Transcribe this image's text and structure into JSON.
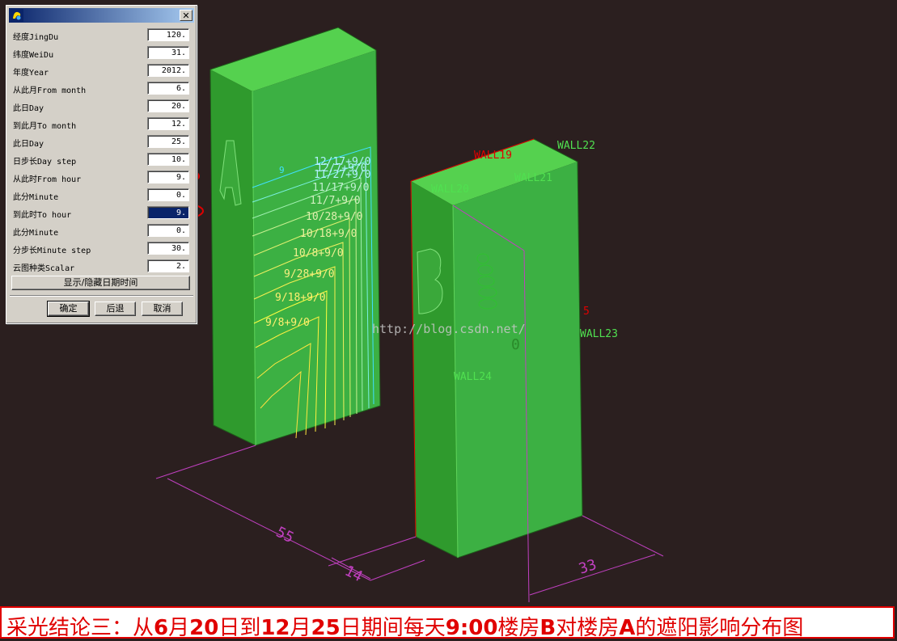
{
  "dialog": {
    "close_label": "✕",
    "fields": [
      {
        "label": "经度JingDu",
        "value": "120."
      },
      {
        "label": "纬度WeiDu",
        "value": "31."
      },
      {
        "label": "年度Year",
        "value": "2012."
      },
      {
        "label": "从此月From month",
        "value": "6."
      },
      {
        "label": "此日Day",
        "value": "20."
      },
      {
        "label": "到此月To month",
        "value": "12."
      },
      {
        "label": "此日Day",
        "value": "25."
      },
      {
        "label": "日步长Day step",
        "value": "10."
      },
      {
        "label": "从此时From hour",
        "value": "9."
      },
      {
        "label": "此分Minute",
        "value": "0."
      },
      {
        "label": "到此时To hour",
        "value": "9."
      },
      {
        "label": "此分Minute",
        "value": "0."
      },
      {
        "label": "分步长Minute step",
        "value": "30."
      },
      {
        "label": "云图种类Scalar",
        "value": "2."
      }
    ],
    "toggle_button": "显示/隐藏日期时间",
    "ok_button": "确定",
    "back_button": "后退",
    "cancel_button": "取消"
  },
  "scene": {
    "building_a_letter": "A",
    "building_b_letter": "B",
    "contour_labels": [
      "12/17+9/0",
      "12/7+9/0",
      "11/27+9/0",
      "11/17+9/0",
      "11/7+9/0",
      "10/28+9/0",
      "10/18+9/0",
      "10/8+9/0",
      "9/28+9/0",
      "9/18+9/0",
      "9/8+9/0"
    ],
    "small_label": "9",
    "wall_labels": {
      "wall19": "WALL19",
      "wall20": "WALL20",
      "wall21": "WALL21",
      "wall22": "WALL22",
      "wall23": "WALL23",
      "wall24": "WALL24"
    },
    "red_mark": "5",
    "dimensions": {
      "length": "55",
      "gap": "14",
      "width": "33"
    },
    "watermark": "http://blog.csdn.net/",
    "b_face_mark": "0"
  },
  "caption": {
    "p1": "采光结论三：从",
    "m1": "6",
    "p2": "月",
    "d1": "20",
    "p3": "日到",
    "m2": "12",
    "p4": "月",
    "d2": "25",
    "p5": "日期间每天",
    "t": "9:00",
    "p6": "楼房",
    "b": "B",
    "p7": "对楼房",
    "a": "A",
    "p8": "的遮阳影响分布图"
  },
  "colors": {
    "background": "#2b1f1f",
    "building": "#3cb043",
    "highlight": "#e00000",
    "dimension": "#c040c0"
  }
}
